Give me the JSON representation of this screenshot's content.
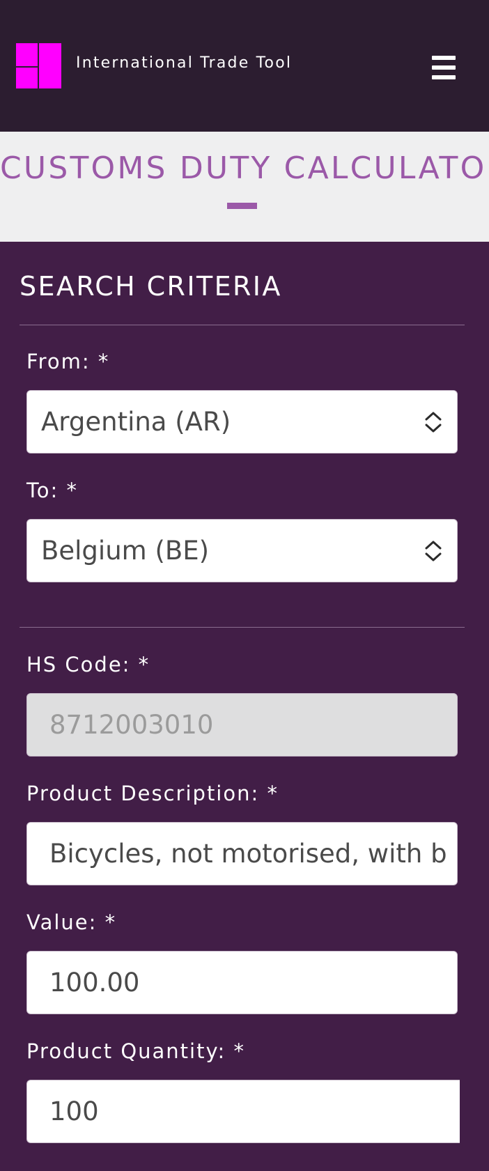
{
  "header": {
    "brand": "International Trade Tool",
    "logo_icon": "app-logo-icon",
    "menu_icon": "hamburger-menu-icon",
    "logo_color": "#ff00ff"
  },
  "page": {
    "title": "CUSTOMS DUTY CALCULATOR"
  },
  "form": {
    "section_title": "SEARCH CRITERIA",
    "from": {
      "label": "From: *",
      "value": "Argentina (AR)"
    },
    "to": {
      "label": "To: *",
      "value": "Belgium (BE)"
    },
    "hs_code": {
      "label": "HS Code: *",
      "value": "8712003010"
    },
    "description": {
      "label": "Product Description: *",
      "value": "Bicycles, not motorised, with b"
    },
    "value": {
      "label": "Value: *",
      "value": "100.00"
    },
    "quantity": {
      "label": "Product Quantity: *",
      "value": "100"
    }
  },
  "colors": {
    "header_bg": "#2c1d30",
    "panel_bg": "#421e47",
    "accent": "#9b59a8",
    "title_band_bg": "#efeff0"
  }
}
